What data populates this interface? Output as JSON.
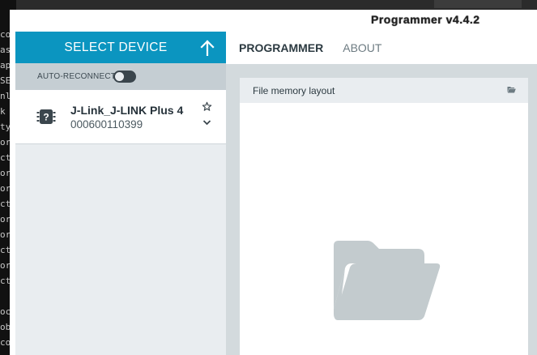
{
  "terminal": {
    "lines": [
      "co",
      "as",
      "ap",
      "SE",
      "nl",
      "k ",
      "ty",
      "or",
      "ct",
      "or",
      "or",
      "ct",
      "or",
      "or",
      "ct",
      "or",
      "ct",
      "oc",
      "ob",
      "co"
    ]
  },
  "window": {
    "title": "Programmer v4.4.2"
  },
  "sidebar": {
    "select_label": "SELECT DEVICE",
    "auto_reconnect_label": "AUTO-RECONNECT",
    "auto_reconnect_on": false,
    "device": {
      "name": "J-Link_J-LINK Plus 4",
      "serial": "000600110399"
    }
  },
  "main": {
    "tabs": [
      {
        "label": "PROGRAMMER",
        "active": true
      },
      {
        "label": "ABOUT",
        "active": false
      }
    ],
    "card": {
      "title": "File memory layout"
    }
  },
  "colors": {
    "accent": "#0b95c0",
    "sidebar_bg": "#e9edf0",
    "reconnect_bg": "#c5ced3",
    "main_bg": "#d3dadd",
    "folder_gray": "#c3cbce"
  },
  "icons": [
    "up-arrow-icon",
    "chip-question-icon",
    "star-icon",
    "chevron-down-icon",
    "folder-open-icon"
  ]
}
